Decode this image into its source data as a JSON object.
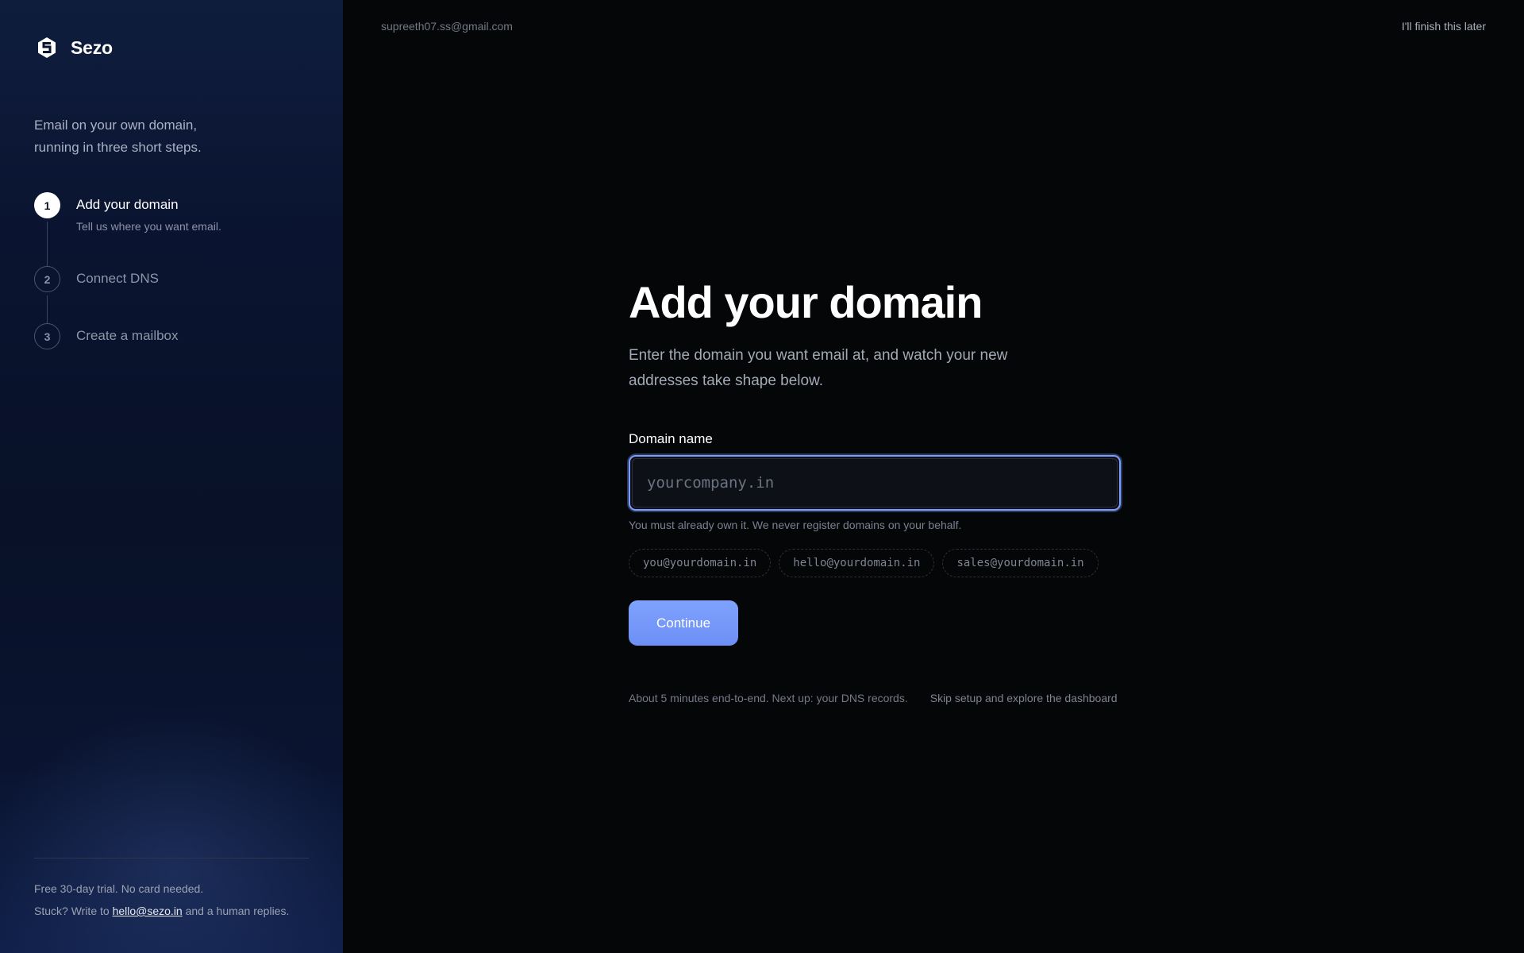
{
  "brand": {
    "name": "Sezo",
    "logo_icon": "sezo-logo-icon"
  },
  "sidebar": {
    "tagline_line1": "Email on your own domain,",
    "tagline_line2": "running in three short steps.",
    "steps": [
      {
        "number": "1",
        "title": "Add your domain",
        "subtitle": "Tell us where you want email.",
        "state": "active"
      },
      {
        "number": "2",
        "title": "Connect DNS",
        "state": "upcoming"
      },
      {
        "number": "3",
        "title": "Create a mailbox",
        "state": "upcoming"
      }
    ],
    "footer": {
      "trial": "Free 30-day trial. No card needed.",
      "stuck_prefix": "Stuck? Write to ",
      "support_email": "hello@sezo.in",
      "stuck_suffix": " and a human replies."
    }
  },
  "header": {
    "user_email": "supreeth07.ss@gmail.com",
    "finish_later": "I'll finish this later"
  },
  "main": {
    "title": "Add your domain",
    "lead_line1": "Enter the domain you want email at, and watch your new",
    "lead_line2": "addresses take shape below.",
    "field_label": "Domain name",
    "domain_value": "",
    "domain_placeholder": "yourcompany.in",
    "hint": "You must already own it. We never register domains on your behalf.",
    "preview_addresses": [
      "you@yourdomain.in",
      "hello@yourdomain.in",
      "sales@yourdomain.in"
    ],
    "continue_label": "Continue",
    "eta_note": "About 5 minutes end-to-end. Next up: your DNS records.",
    "skip_label": "Skip setup and explore the dashboard"
  },
  "colors": {
    "accent": "#7c9cff",
    "button": "#7599fb",
    "background": "#050608",
    "sidebar": "#0a1430"
  }
}
